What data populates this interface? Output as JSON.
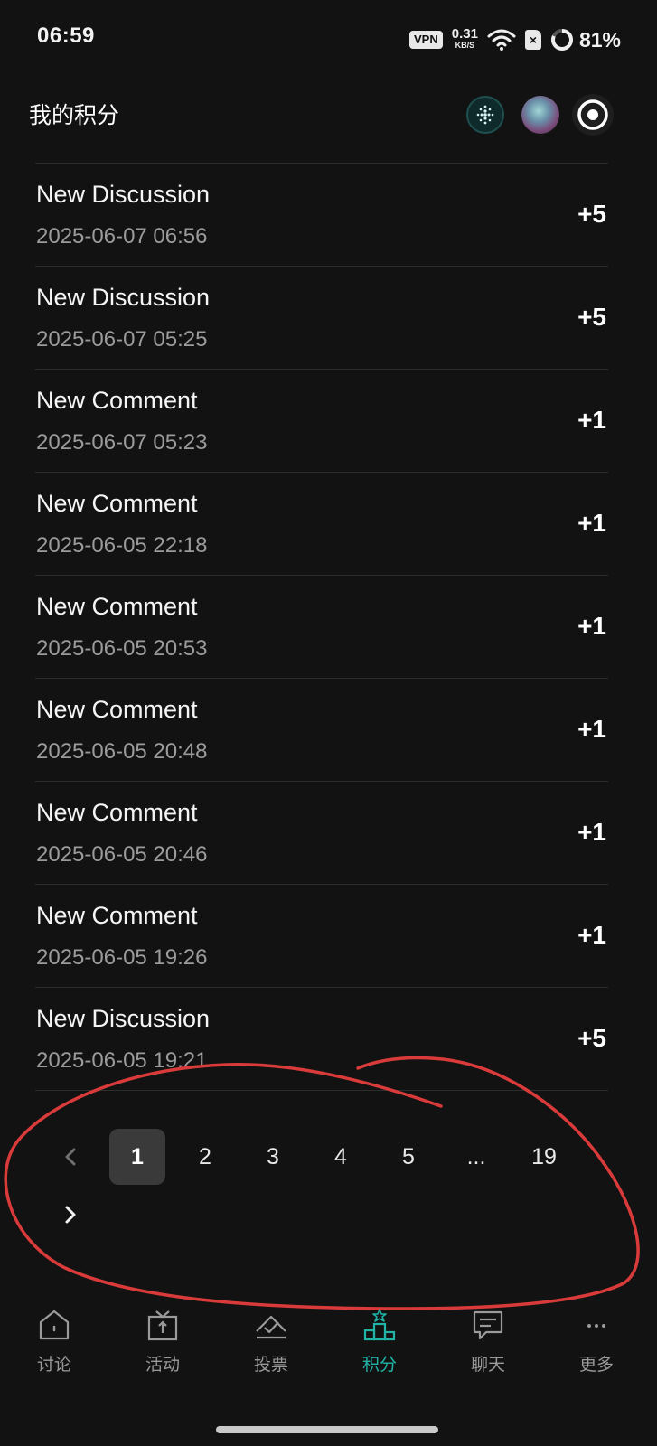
{
  "status_bar": {
    "time": "06:59",
    "vpn": "VPN",
    "net_speed_value": "0.31",
    "net_speed_unit": "KB/S",
    "battery": "81%"
  },
  "header": {
    "title": "我的积分"
  },
  "records": [
    {
      "title": "New Discussion",
      "date": "2025-06-07 06:56",
      "points": "+5"
    },
    {
      "title": "New Discussion",
      "date": "2025-06-07 05:25",
      "points": "+5"
    },
    {
      "title": "New Comment",
      "date": "2025-06-07 05:23",
      "points": "+1"
    },
    {
      "title": "New Comment",
      "date": "2025-06-05 22:18",
      "points": "+1"
    },
    {
      "title": "New Comment",
      "date": "2025-06-05 20:53",
      "points": "+1"
    },
    {
      "title": "New Comment",
      "date": "2025-06-05 20:48",
      "points": "+1"
    },
    {
      "title": "New Comment",
      "date": "2025-06-05 20:46",
      "points": "+1"
    },
    {
      "title": "New Comment",
      "date": "2025-06-05 19:26",
      "points": "+1"
    },
    {
      "title": "New Discussion",
      "date": "2025-06-05 19:21",
      "points": "+5"
    }
  ],
  "pagination": {
    "pages": [
      "1",
      "2",
      "3",
      "4",
      "5",
      "...",
      "19"
    ],
    "current": "1"
  },
  "tabs": [
    {
      "label": "讨论",
      "icon": "home-icon"
    },
    {
      "label": "活动",
      "icon": "gift-icon"
    },
    {
      "label": "投票",
      "icon": "vote-icon"
    },
    {
      "label": "积分",
      "icon": "podium-icon",
      "active": true
    },
    {
      "label": "聊天",
      "icon": "chat-icon"
    },
    {
      "label": "更多",
      "icon": "more-icon"
    }
  ],
  "colors": {
    "background": "#121212",
    "accent": "#20b3a6",
    "annotation": "#d93a3a"
  }
}
